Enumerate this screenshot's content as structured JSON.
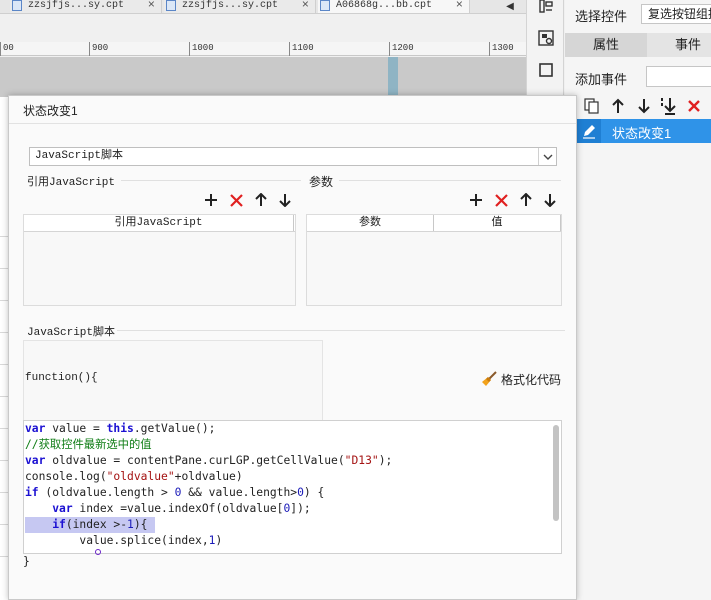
{
  "file_tabs": [
    {
      "name": "zzsjfjs...sy.cpt",
      "close": "×"
    },
    {
      "name": "zzsjfjs...sy.cpt",
      "close": "×"
    },
    {
      "name": "A06868g...bb.cpt",
      "close": "×"
    }
  ],
  "tab_scroll_glyph": "◀",
  "ruler": {
    "marks": [
      "00",
      "900",
      "1000",
      "1100",
      "1200",
      "1300"
    ]
  },
  "right_panel": {
    "select_label": "选择控件",
    "select_value": "复选按钮组控",
    "tabs": [
      {
        "label": "属性",
        "active": true
      },
      {
        "label": "事件",
        "active": false
      }
    ],
    "add_event_label": "添加事件",
    "toolbar_icons": [
      "copy-icon",
      "arrow-up-icon",
      "arrow-down-icon",
      "move-bottom-icon",
      "delete-icon"
    ],
    "event_item": "状态改变1"
  },
  "dialog": {
    "title": "状态改变1",
    "language_select": "JavaScript脚本",
    "ref_js_section": "引用JavaScript",
    "params_section": "参数",
    "ref_js_table_headers": [
      "引用JavaScript"
    ],
    "params_table_headers": [
      "参数",
      "值"
    ],
    "script_section": "JavaScript脚本",
    "function_signature": "function(){",
    "format_button": "格式化代码",
    "closing_brace": "}",
    "code_lines": [
      "var value = this.getValue();",
      "//获取控件最新选中的值",
      "var oldvalue = contentPane.curLGP.getCellValue(\"D13\");",
      "console.log(\"oldvalue\"+oldvalue)",
      "if (oldvalue.length > 0 && value.length>0) {",
      "    var index =value.indexOf(oldvalue[0]);",
      "    if(index >-1){",
      "        value.splice(index,1)"
    ]
  },
  "colors": {
    "accent": "#2f93e8",
    "delete_red": "#e02020",
    "keyword": "#1b10d2",
    "comment": "#0f7d15",
    "string": "#a41212",
    "highlight": "#c6c8f2"
  }
}
